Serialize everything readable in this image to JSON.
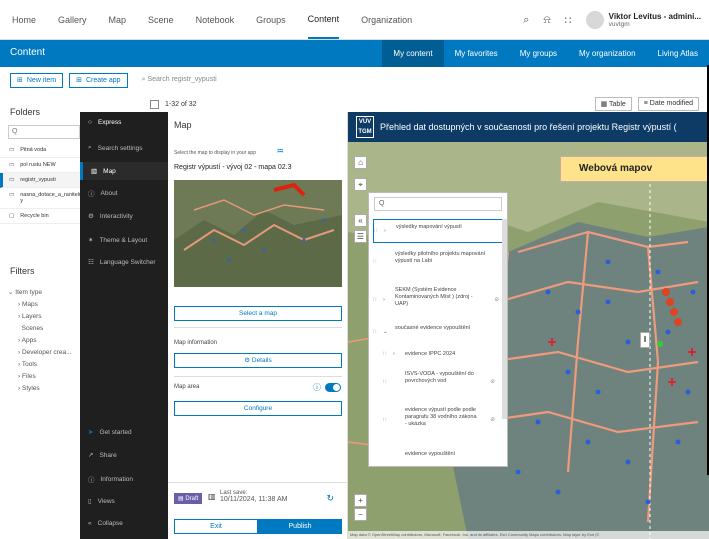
{
  "topnav": {
    "items": [
      "Home",
      "Gallery",
      "Map",
      "Scene",
      "Notebook",
      "Groups",
      "Content",
      "Organization"
    ],
    "active": "Content",
    "user_name": "Viktor Levitus - admini...",
    "user_sub": "vuvtgm"
  },
  "band": {
    "title": "Content",
    "tabs": [
      "My content",
      "My favorites",
      "My groups",
      "My organization",
      "Living Atlas"
    ]
  },
  "toolbar": {
    "new_item": "New item",
    "create_app": "Create app",
    "search_placeholder": "Search registr_vypusti"
  },
  "folders": {
    "title": "Folders",
    "search": "Q",
    "items": [
      "Pitná voda",
      "pol rustu NEW",
      "registr_vypusti",
      "nasna_dotace_a_ranitelnost_kvanti y",
      "Recycle bin"
    ]
  },
  "filters": {
    "title": "Filters",
    "item_type": "Item type",
    "items": [
      "Maps",
      "Layers",
      "Scenes",
      "Apps",
      "Developer crea...",
      "Tools",
      "Files",
      "Styles"
    ]
  },
  "list": {
    "count": "1-32 of 32",
    "table": "Table",
    "sort": "Date modified"
  },
  "express": {
    "title": "Express",
    "items": [
      "Search settings",
      "Map",
      "About",
      "Interactivity",
      "Theme & Layout",
      "Language Switcher"
    ],
    "bottom": [
      "Get started",
      "Share",
      "Information",
      "Views",
      "Collapse"
    ]
  },
  "mappanel": {
    "head": "Map",
    "sub": "Select the map to display in your app",
    "map_title": "Registr výpustí - vývoj 02 - mapa 02.3",
    "select_map": "Select a map",
    "map_info": "Map information",
    "details": "Details",
    "map_area": "Map area",
    "configure": "Configure",
    "draft": "Draft",
    "last_save_label": "Last save:",
    "last_save_value": "10/11/2024, 11:38 AM",
    "exit": "Exit",
    "publish": "Publish"
  },
  "app": {
    "logo_line1": "VÚV",
    "logo_line2": "TGM",
    "title": "Přehled dat dostupných v současnosti pro řešení projektu Registr výpustí (",
    "banner": "Webová mapov",
    "layer_search": "Q",
    "layers": [
      "výsledky mapování výpustí",
      "výsledky pilotního projektu mapování výpustí na Labi",
      "SEKM (Systém Evidence Kontaminovaných Míst ) (zdroj - UAP)",
      "současné evidence vypouštění",
      "evidence IPPC 2024",
      "ISVS-VODA - vypouštění do povrchových vod",
      "evidence výpustí podle podle paragrafu 38 vodního zákona - ukázka",
      "evidence vypouštění"
    ],
    "attribution": "Map data © OpenStreetMap contributors, Microsoft, Facebook, Inc. and its affiliates, Esri Community Maps contributors, Map layer by Esri |©"
  },
  "colors": {
    "accent": "#0079c1",
    "dark": "#1f1f1f",
    "header": "#0d3b66",
    "banner": "#ffe38a"
  }
}
